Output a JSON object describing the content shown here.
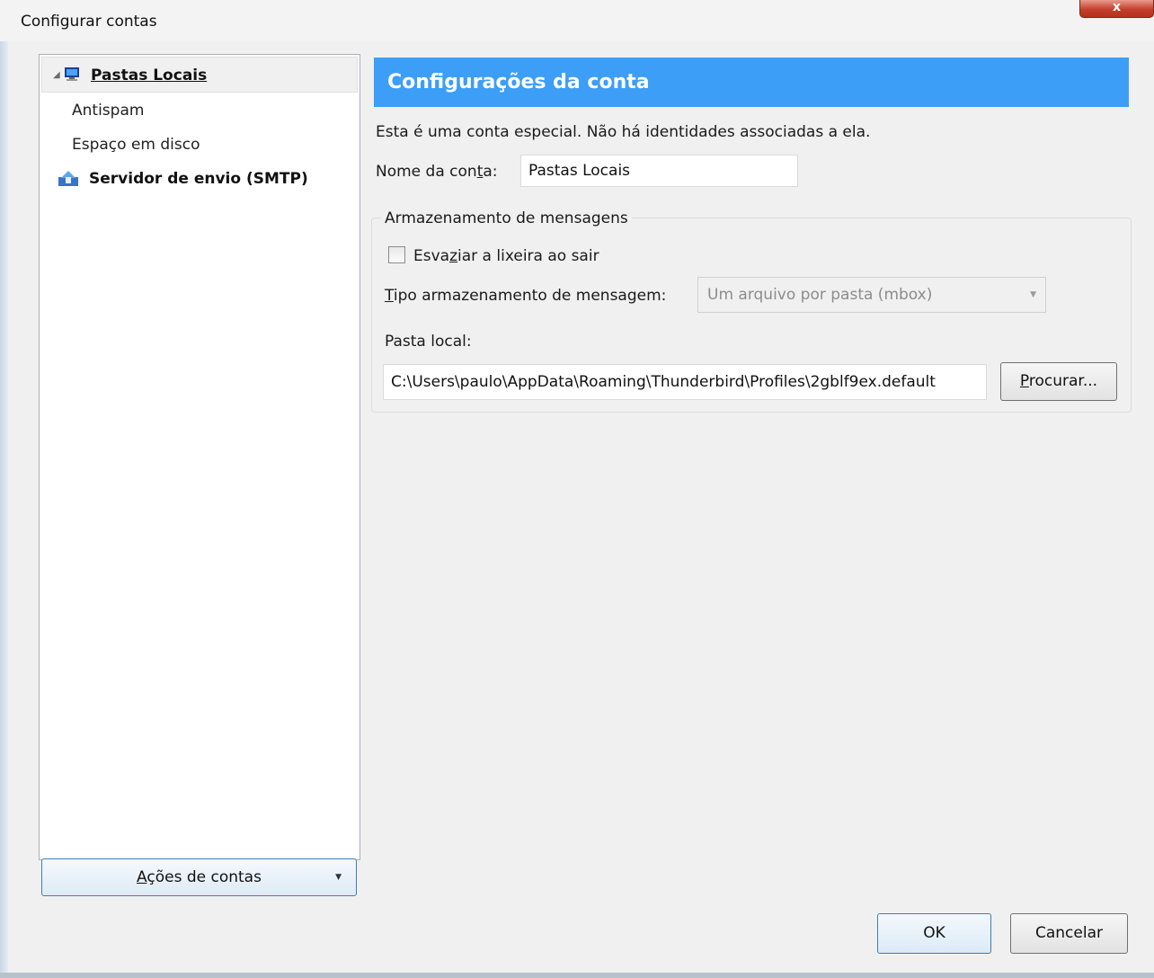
{
  "window": {
    "title": "Configurar contas",
    "close_label": "x"
  },
  "tree": {
    "root": {
      "label": "Pastas Locais",
      "expanded": true
    },
    "children": [
      "Antispam",
      "Espaço em disco"
    ],
    "smtp": {
      "label": "Servidor de envio (SMTP)"
    }
  },
  "account_actions": {
    "label": "Ações de contas",
    "mnemonic": "A"
  },
  "settings": {
    "header": "Configurações da conta",
    "description": "Esta é uma conta especial. Não há identidades associadas a ela.",
    "account_name": {
      "label": "Nome da conta:",
      "mnemonic": "t",
      "value": "Pastas Locais"
    },
    "storage": {
      "legend": "Armazenamento de mensagens",
      "empty_trash": {
        "label": "Esvaziar a lixeira ao sair",
        "mnemonic": "z",
        "checked": false
      },
      "store_type": {
        "label": "Tipo armazenamento de mensagem:",
        "mnemonic": "T",
        "value": "Um arquivo por pasta (mbox)",
        "disabled": true
      },
      "local_dir": {
        "label": "Pasta local:",
        "value": "C:\\Users\\paulo\\AppData\\Roaming\\Thunderbird\\Profiles\\2gblf9ex.default"
      },
      "browse": {
        "label": "Procurar...",
        "mnemonic": "P"
      }
    }
  },
  "footer": {
    "ok": "OK",
    "cancel": "Cancelar"
  },
  "colors": {
    "header_bg": "#3c9ef7",
    "close_red": "#c4402c",
    "button_focus": "#3c7fb1"
  }
}
